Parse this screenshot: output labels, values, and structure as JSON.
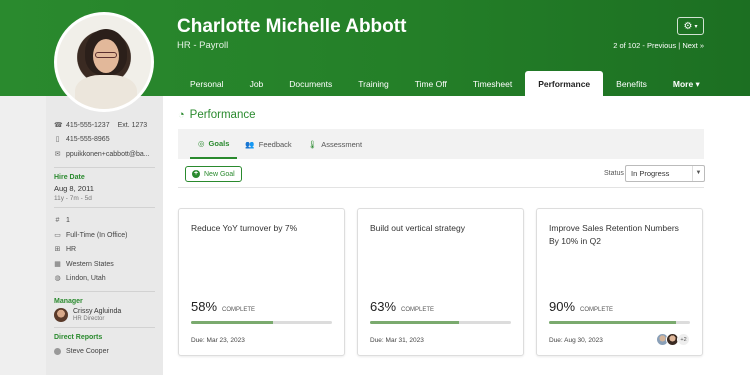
{
  "employee": {
    "name": "Charlotte Michelle Abbott",
    "department": "HR - Payroll"
  },
  "header": {
    "pager_text": "2 of 102 - ",
    "pager_prev": "Previous",
    "pager_sep": " | ",
    "pager_next": "Next »",
    "gear_icon": "gear-icon"
  },
  "tabs": [
    {
      "label": "Personal"
    },
    {
      "label": "Job"
    },
    {
      "label": "Documents"
    },
    {
      "label": "Training"
    },
    {
      "label": "Time Off"
    },
    {
      "label": "Timesheet"
    },
    {
      "label": "Performance",
      "active": true
    },
    {
      "label": "Benefits"
    },
    {
      "label": "More ▾"
    }
  ],
  "contact": {
    "work_phone": "415-555-1237",
    "ext": "Ext. 1273",
    "mobile_phone": "415-555-8965",
    "email": "ppuikkonen+cabbott@ba..."
  },
  "hire": {
    "title": "Hire Date",
    "date": "Aug 8, 2011",
    "tenure": "11y - 7m - 5d"
  },
  "job_info": {
    "employee_number": "1",
    "employment_status": "Full-Time (In Office)",
    "division": "HR",
    "location": "Western States",
    "city": "Lindon, Utah"
  },
  "manager": {
    "title": "Manager",
    "name": "Crissy Agluinda",
    "role": "HR Director"
  },
  "direct_reports": {
    "title": "Direct Reports",
    "first": "Steve Cooper"
  },
  "main": {
    "title": "Performance",
    "subtabs": [
      {
        "label": "Goals",
        "icon": "target-icon",
        "active": true
      },
      {
        "label": "Feedback",
        "icon": "people-icon"
      },
      {
        "label": "Assessment",
        "icon": "thermometer-icon"
      }
    ],
    "new_goal_label": "New Goal",
    "status_label": "Status",
    "status_value": "In Progress"
  },
  "goals": [
    {
      "title": "Reduce YoY turnover by 7%",
      "percent": "58%",
      "progress": 0.58,
      "complete_label": "COMPLETE",
      "due": "Due: Mar 23, 2023"
    },
    {
      "title": "Build out vertical strategy",
      "percent": "63%",
      "progress": 0.63,
      "complete_label": "COMPLETE",
      "due": "Due: Mar 31, 2023"
    },
    {
      "title": "Improve Sales Retention Numbers By 10% in Q2",
      "percent": "90%",
      "progress": 0.9,
      "complete_label": "COMPLETE",
      "due": "Due: Aug 30, 2023",
      "extra_people": "+2"
    }
  ],
  "colors": {
    "brand_green": "#2a8a2e",
    "progress_fill": "#7aaa6e"
  }
}
